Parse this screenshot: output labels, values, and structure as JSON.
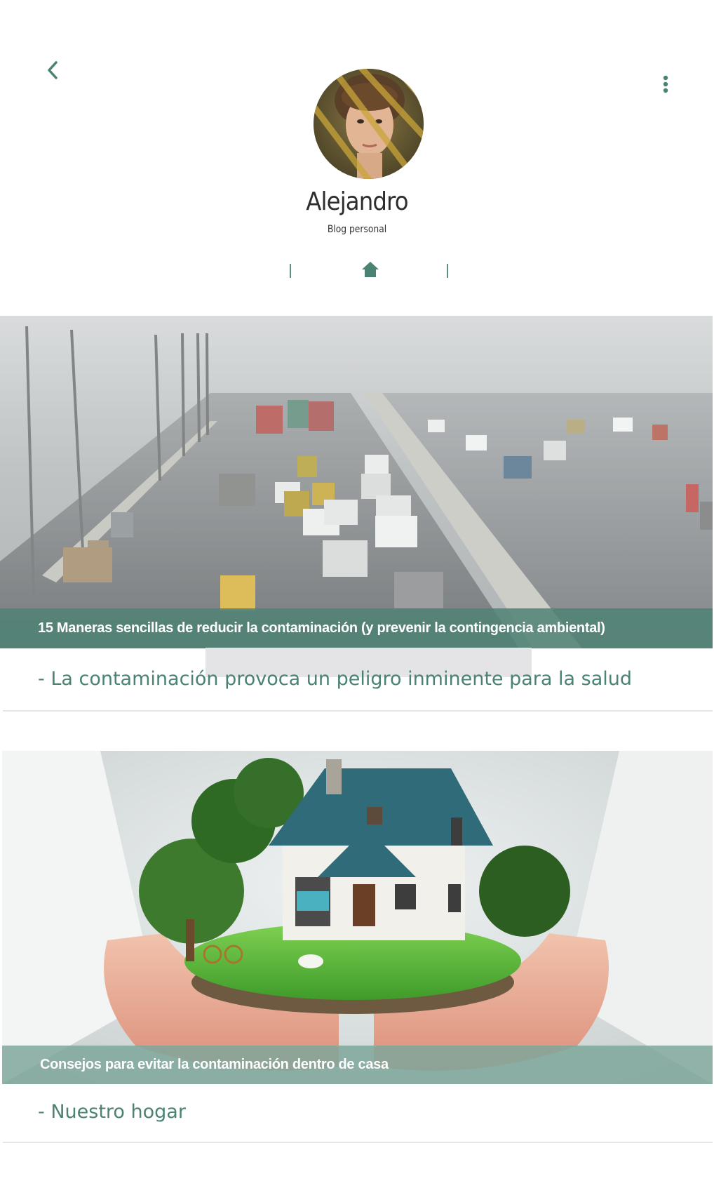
{
  "header": {
    "back_icon": "chevron-left-icon",
    "more_icon": "more-vertical-icon"
  },
  "profile": {
    "name": "Alejandro",
    "subtitle": "Blog personal"
  },
  "nav": {
    "home_icon": "home-icon"
  },
  "colors": {
    "accent": "#4a8273",
    "caption_bar_1": "#4f8374",
    "caption_bar_2": "#7fa79b"
  },
  "posts": [
    {
      "title": "15 Maneras sencillas de reducir la contaminación (y prevenir la contingencia ambiental)",
      "subtitle": "- La contaminación provoca un peligro inminente para la salud"
    },
    {
      "title": "Consejos para evitar la contaminación dentro de casa",
      "subtitle": "- Nuestro hogar"
    }
  ]
}
